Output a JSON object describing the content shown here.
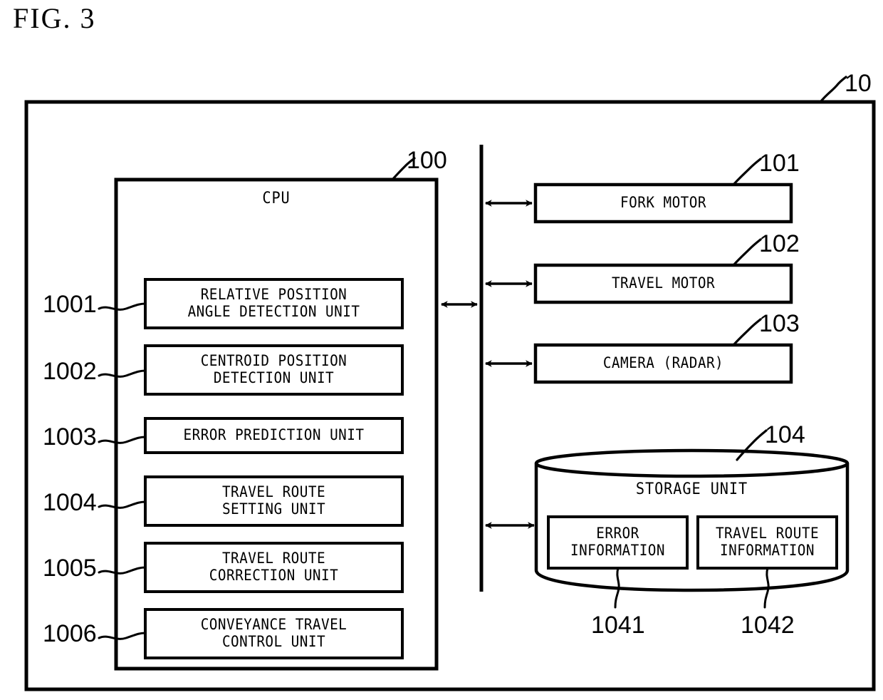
{
  "figure": {
    "title": "FIG. 3",
    "system_ref": "10"
  },
  "cpu": {
    "title": "CPU",
    "ref": "100",
    "units": [
      {
        "ref": "1001",
        "label": "RELATIVE POSITION\nANGLE DETECTION UNIT"
      },
      {
        "ref": "1002",
        "label": "CENTROID POSITION\nDETECTION UNIT"
      },
      {
        "ref": "1003",
        "label": "ERROR PREDICTION UNIT"
      },
      {
        "ref": "1004",
        "label": "TRAVEL ROUTE\nSETTING UNIT"
      },
      {
        "ref": "1005",
        "label": "TRAVEL ROUTE\nCORRECTION UNIT"
      },
      {
        "ref": "1006",
        "label": "CONVEYANCE TRAVEL\nCONTROL UNIT"
      }
    ]
  },
  "peripherals": [
    {
      "ref": "101",
      "label": "FORK MOTOR"
    },
    {
      "ref": "102",
      "label": "TRAVEL MOTOR"
    },
    {
      "ref": "103",
      "label": "CAMERA (RADAR)"
    }
  ],
  "storage": {
    "ref": "104",
    "title": "STORAGE UNIT",
    "items": [
      {
        "ref": "1041",
        "label": "ERROR\nINFORMATION"
      },
      {
        "ref": "1042",
        "label": "TRAVEL ROUTE\nINFORMATION"
      }
    ]
  },
  "colors": {
    "stroke": "#000000",
    "background": "#ffffff"
  }
}
